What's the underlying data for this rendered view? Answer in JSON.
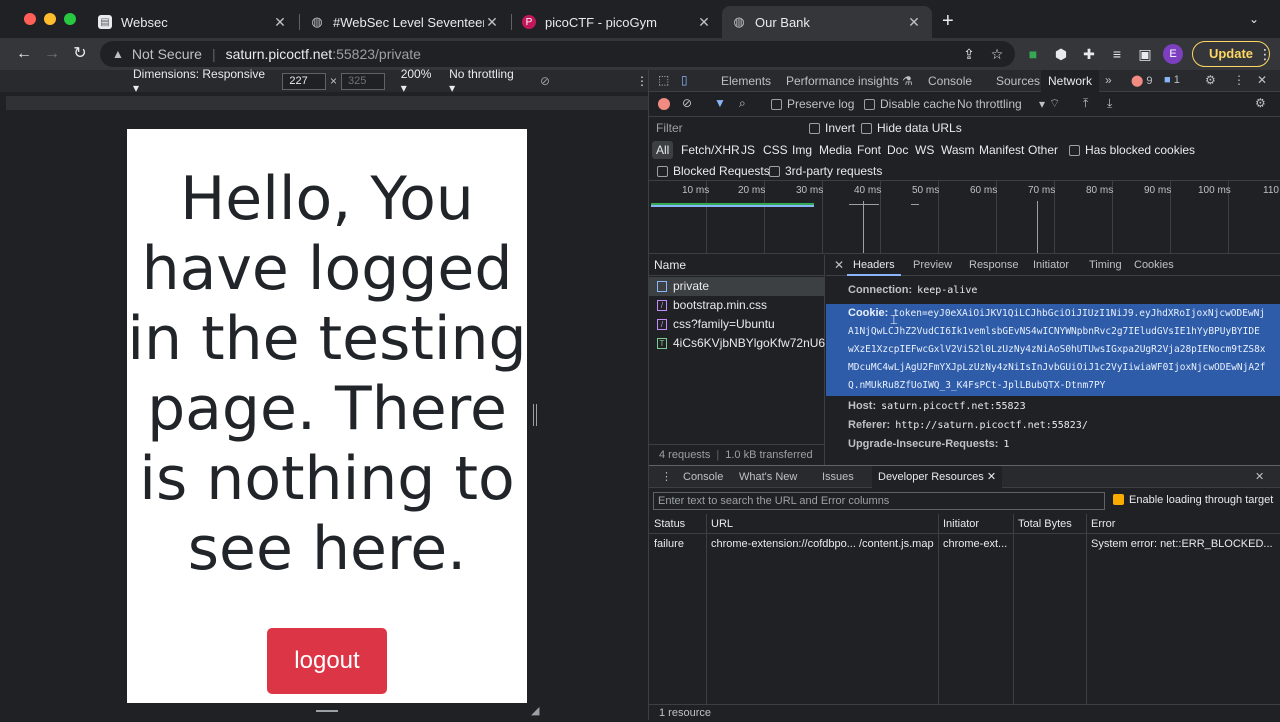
{
  "browser": {
    "tabs": [
      {
        "title": "Websec"
      },
      {
        "title": "#WebSec Level Seventeen"
      },
      {
        "title": "picoCTF - picoGym"
      },
      {
        "title": "Our Bank"
      }
    ],
    "new_tab": "+",
    "address": {
      "security": "Not Secure",
      "host": "saturn.picoctf.net",
      "path": ":55823/private"
    },
    "profile_initial": "E",
    "update_label": "Update"
  },
  "device_toolbar": {
    "dimensions_label": "Dimensions: Responsive",
    "width": "227",
    "height": "325",
    "zoom": "200%",
    "throttling": "No throttling"
  },
  "page": {
    "message": "Hello, You have logged in the testing page. There is nothing to see here.",
    "logout_label": "logout"
  },
  "devtools": {
    "tabs": [
      "Elements",
      "Performance insights",
      "Console",
      "Sources",
      "Network"
    ],
    "error_count": "9",
    "message_count": "1",
    "network_toolbar": {
      "preserve_log": "Preserve log",
      "disable_cache": "Disable cache",
      "throttling": "No throttling"
    },
    "filter": {
      "placeholder": "Filter",
      "invert": "Invert",
      "hide_data_urls": "Hide data URLs"
    },
    "types": [
      "All",
      "Fetch/XHR",
      "JS",
      "CSS",
      "Img",
      "Media",
      "Font",
      "Doc",
      "WS",
      "Wasm",
      "Manifest",
      "Other"
    ],
    "has_blocked_cookies": "Has blocked cookies",
    "blocked_requests": "Blocked Requests",
    "third_party": "3rd-party requests",
    "timeline_ticks": [
      "10 ms",
      "20 ms",
      "30 ms",
      "40 ms",
      "50 ms",
      "60 ms",
      "70 ms",
      "80 ms",
      "90 ms",
      "100 ms",
      "110"
    ],
    "name_header": "Name",
    "requests": [
      "private",
      "bootstrap.min.css",
      "css?family=Ubuntu",
      "4iCs6KVjbNBYlgoKfw72nU6..."
    ],
    "summary": {
      "requests": "4 requests",
      "transferred": "1.0 kB transferred"
    },
    "header_tabs": [
      "Headers",
      "Preview",
      "Response",
      "Initiator",
      "Timing",
      "Cookies"
    ],
    "headers": {
      "connection_key": "Connection:",
      "connection_val": "keep-alive",
      "cookie_key": "Cookie:",
      "cookie_lines": [
        "token=eyJ0eXAiOiJKV1QiLCJhbGciOiJIUzI1NiJ9.eyJhdXRoIjoxNjcwODEwNj",
        "A1NjQwLCJhZ2VudCI6Ik1vemlsbGEvNS4wICNYWNpbnRvc2g7IEludGVsIE1hYyBPUyBYIDE",
        "wXzE1XzcpIEFwcGxlV2ViS2l0LzUzNy4zNiAoS0hUTUwsIGxpa2UgR2Vja28pIENocm9tZS8x",
        "MDcuMC4wLjAgU2FmYXJpLzUzNy4zNiIsInJvbGUiOiJ1c2VyIiwiaWF0IjoxNjcwODEwNjA2f",
        "Q.nMUkRu8ZfUoIWQ_3_K4FsPCt-JplLBubQTX-Dtnm7PY"
      ],
      "host_key": "Host:",
      "host_val": "saturn.picoctf.net:55823",
      "referer_key": "Referer:",
      "referer_val": "http://saturn.picoctf.net:55823/",
      "upgrade_key": "Upgrade-Insecure-Requests:",
      "upgrade_val": "1"
    },
    "drawer": {
      "tabs": [
        "Console",
        "What's New",
        "Issues",
        "Developer Resources"
      ],
      "filter_placeholder": "Enter text to search the URL and Error columns",
      "enable_loading": "Enable loading through target",
      "columns": [
        "Status",
        "URL",
        "Initiator",
        "Total Bytes",
        "Error"
      ],
      "row": {
        "status": "failure",
        "url": "chrome-extension://cofdbpo... /content.js.map",
        "initiator": "chrome-ext...",
        "bytes": "",
        "error": "System error: net::ERR_BLOCKED..."
      },
      "footer": "1 resource"
    }
  }
}
